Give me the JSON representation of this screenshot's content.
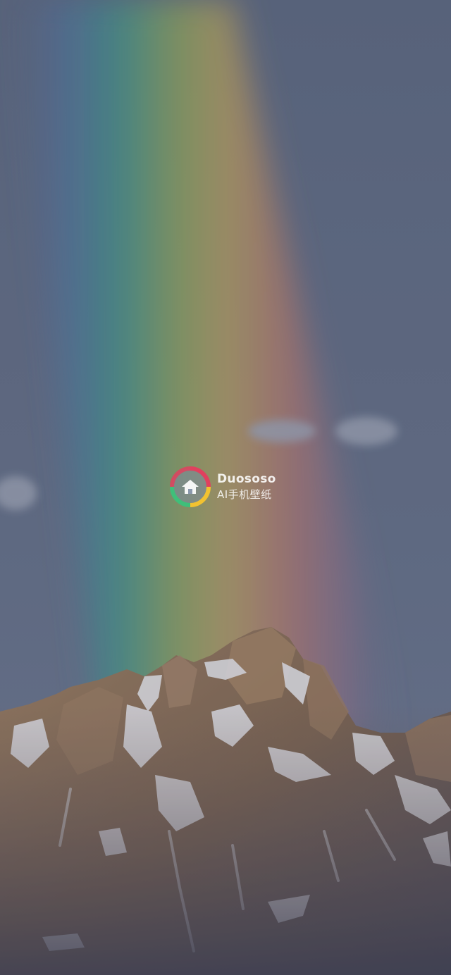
{
  "wallpaper": {
    "subject": "rainbow-over-snowy-mountain"
  },
  "watermark": {
    "brand": "Duososo",
    "tagline": "AI手机壁纸",
    "icon": "house-icon",
    "ring_colors": [
      "#e0415e",
      "#f2c230",
      "#3fbf7a",
      "#2aa7d8"
    ]
  },
  "colors": {
    "sky_top": "#5f6a82",
    "sky_bottom": "#68738a",
    "rock": "#8a6f58",
    "snow": "#e6e6ea"
  }
}
